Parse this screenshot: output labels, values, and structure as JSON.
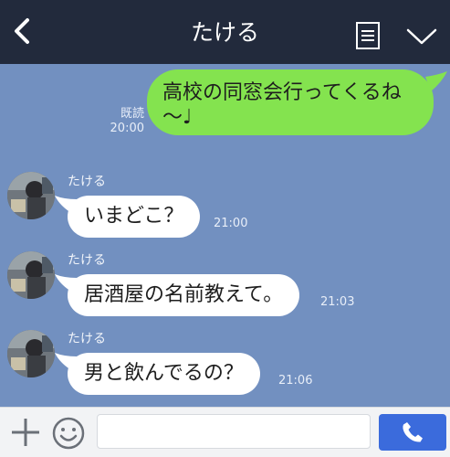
{
  "header": {
    "title": "たける",
    "back_icon": "chevron-left-icon",
    "note_icon": "note-icon",
    "menu_icon": "chevron-down-icon"
  },
  "messages": [
    {
      "direction": "outgoing",
      "text_line1": "高校の同窓会行ってくるね",
      "text_line2": "〜♩",
      "read_label": "既読",
      "time": "20:00"
    },
    {
      "direction": "incoming",
      "sender": "たける",
      "text": "いまどこ？",
      "time": "21:00"
    },
    {
      "direction": "incoming",
      "sender": "たける",
      "text": "居酒屋の名前教えて。",
      "time": "21:03"
    },
    {
      "direction": "incoming",
      "sender": "たける",
      "text": "男と飲んでるの？",
      "time": "21:06"
    }
  ],
  "composer": {
    "input_value": "",
    "plus_icon": "plus-icon",
    "emoji_icon": "smiley-icon",
    "call_icon": "phone-icon"
  },
  "colors": {
    "header_bg": "#222a3c",
    "chat_bg": "#7290c0",
    "outgoing_bubble": "#84e34f",
    "incoming_bubble": "#ffffff",
    "call_button": "#3b6bdc"
  }
}
